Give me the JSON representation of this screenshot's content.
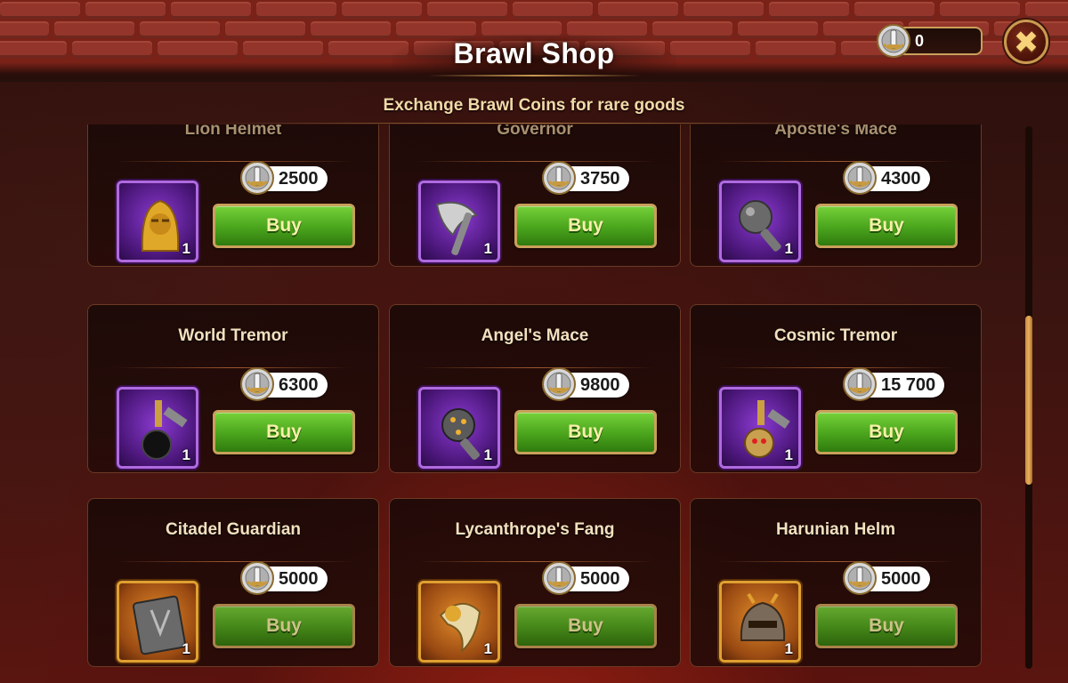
{
  "header": {
    "title": "Brawl Shop",
    "subtitle": "Exchange Brawl Coins for rare goods",
    "coin_balance": "0",
    "close_icon": "close-icon",
    "coin_icon": "brawl-coin-icon"
  },
  "colors": {
    "accent_gold": "#c9a05a",
    "buy_green": "#4aa41c",
    "epic_frame": "#b06ae0",
    "legendary_frame": "#e0a030"
  },
  "items": [
    {
      "name": "Lion Helmet",
      "price": "2500",
      "quantity": "1",
      "buy_label": "Buy",
      "icon": "lion-helmet-icon",
      "rarity": "epic"
    },
    {
      "name": "Governor",
      "price": "3750",
      "quantity": "1",
      "buy_label": "Buy",
      "icon": "axe-icon",
      "rarity": "epic"
    },
    {
      "name": "Apostle's Mace",
      "price": "4300",
      "quantity": "1",
      "buy_label": "Buy",
      "icon": "mace-icon",
      "rarity": "epic"
    },
    {
      "name": "World Tremor",
      "price": "6300",
      "quantity": "1",
      "buy_label": "Buy",
      "icon": "flail-icon",
      "rarity": "epic"
    },
    {
      "name": "Angel's Mace",
      "price": "9800",
      "quantity": "1",
      "buy_label": "Buy",
      "icon": "spiked-mace-icon",
      "rarity": "epic"
    },
    {
      "name": "Cosmic Tremor",
      "price": "15 700",
      "quantity": "1",
      "buy_label": "Buy",
      "icon": "skull-flail-icon",
      "rarity": "epic"
    },
    {
      "name": "Citadel Guardian",
      "price": "5000",
      "quantity": "1",
      "buy_label": "Buy",
      "icon": "armor-plate-icon",
      "rarity": "legendary"
    },
    {
      "name": "Lycanthrope's Fang",
      "price": "5000",
      "quantity": "1",
      "buy_label": "Buy",
      "icon": "fang-icon",
      "rarity": "legendary"
    },
    {
      "name": "Harunian Helm",
      "price": "5000",
      "quantity": "1",
      "buy_label": "Buy",
      "icon": "helm-icon",
      "rarity": "legendary"
    }
  ]
}
